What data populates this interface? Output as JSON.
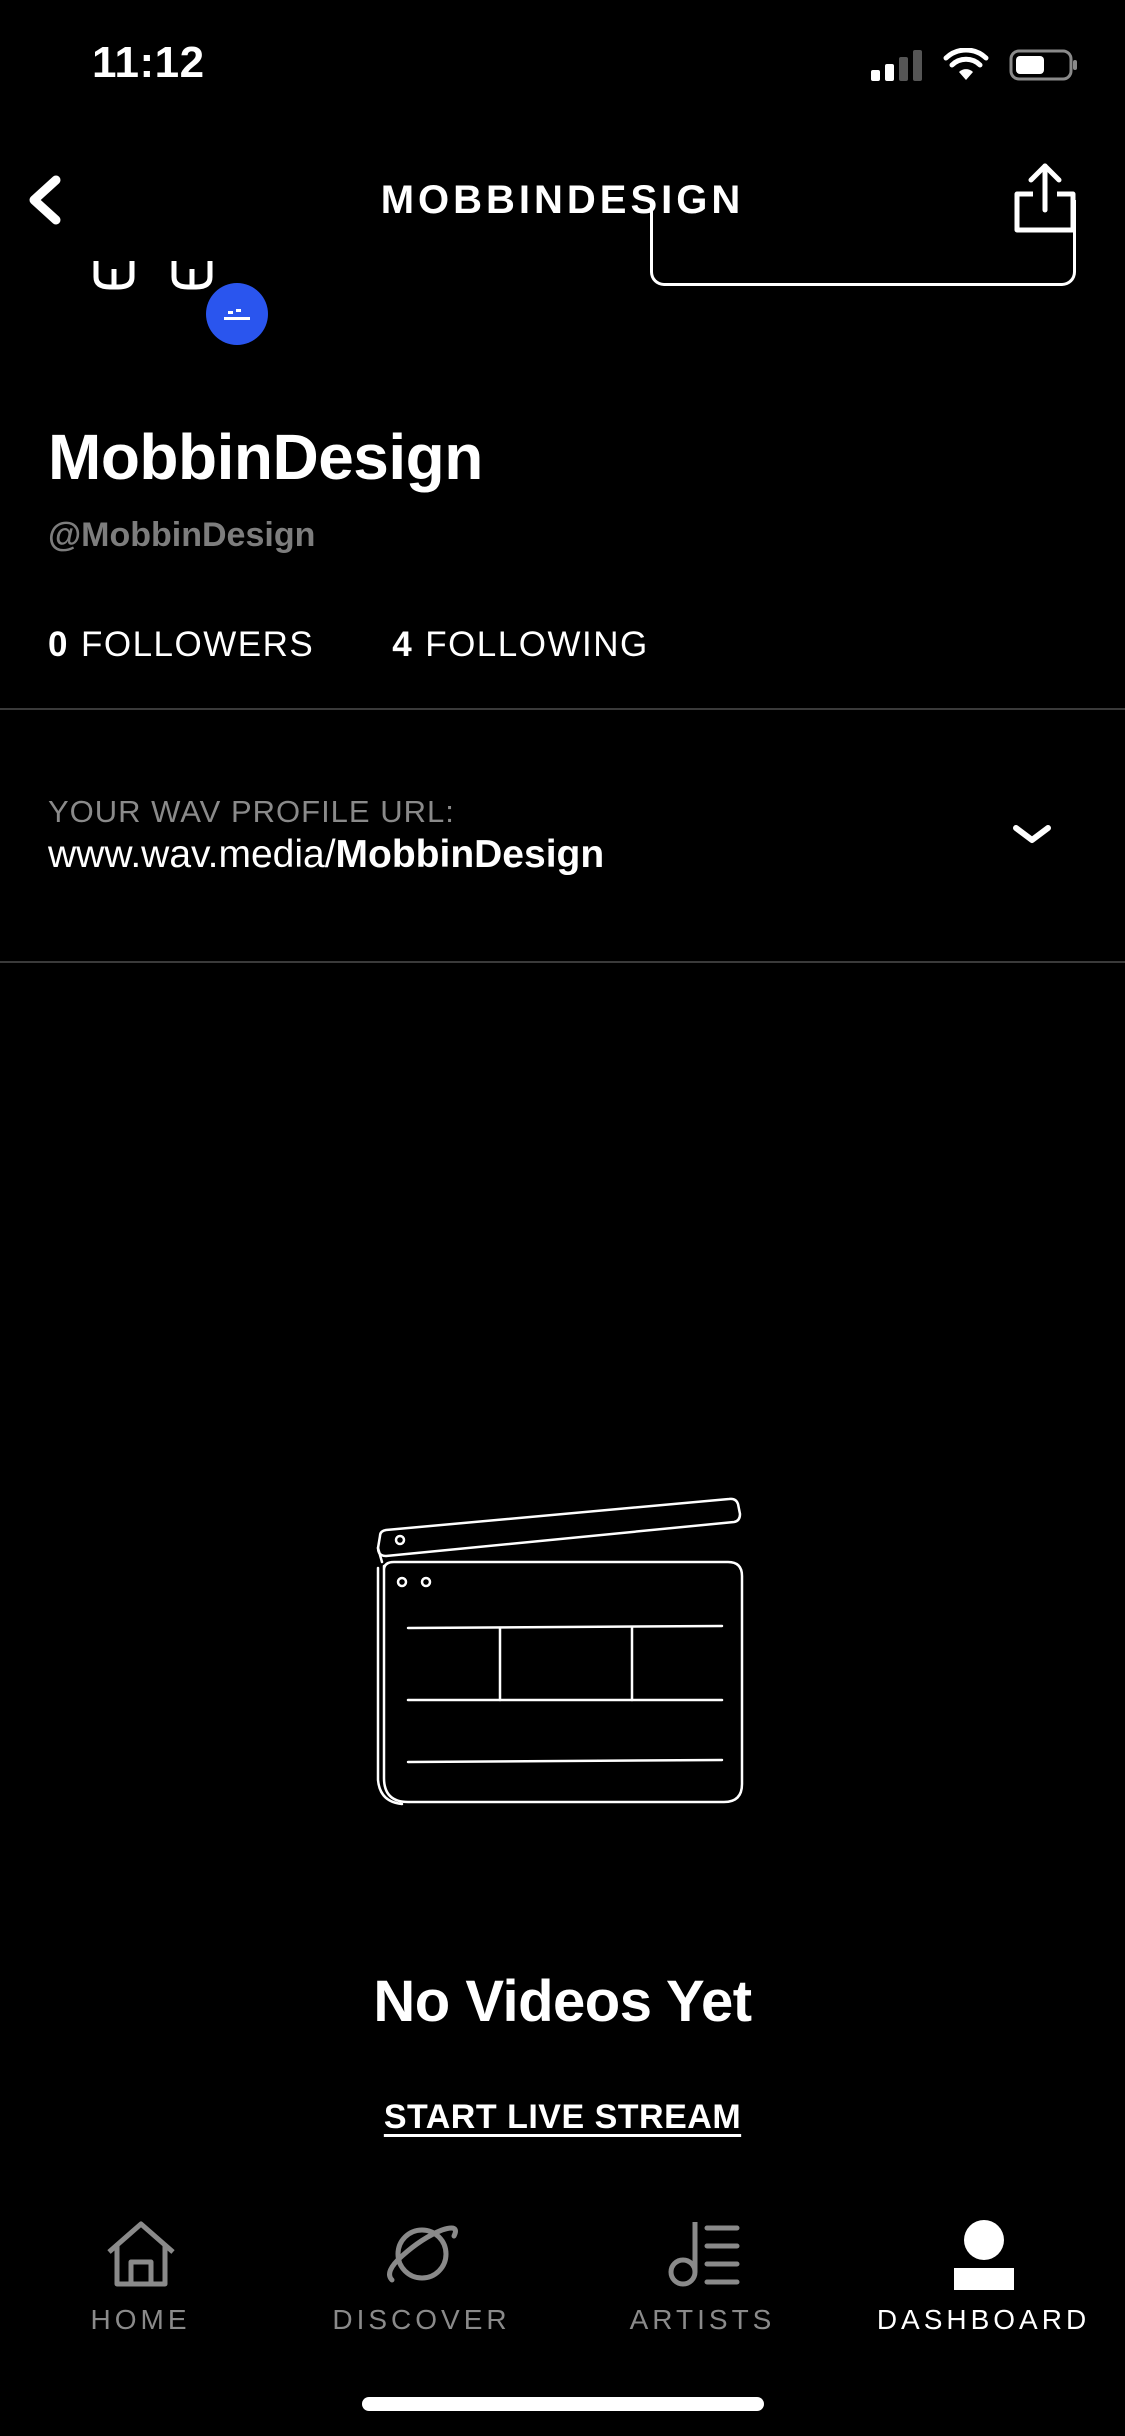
{
  "status_bar": {
    "time": "11:12"
  },
  "nav": {
    "title": "MOBBINDESIGN",
    "back_icon": "chevron-left-icon",
    "share_icon": "share-icon"
  },
  "profile": {
    "name": "MobbinDesign",
    "handle": "@MobbinDesign",
    "followers_count": "0",
    "followers_label": "FOLLOWERS",
    "following_count": "4",
    "following_label": "FOLLOWING"
  },
  "profile_url": {
    "label": "YOUR WAV PROFILE URL:",
    "prefix": "www.wav.media/",
    "username": "MobbinDesign"
  },
  "empty_state": {
    "icon": "clapperboard-icon",
    "title": "No Videos Yet",
    "action": "START LIVE STREAM"
  },
  "tabbar": {
    "items": [
      {
        "label": "HOME",
        "icon": "home-icon",
        "active": false
      },
      {
        "label": "DISCOVER",
        "icon": "planet-icon",
        "active": false
      },
      {
        "label": "ARTISTS",
        "icon": "music-note-list-icon",
        "active": false
      },
      {
        "label": "DASHBOARD",
        "icon": "user-icon",
        "active": true
      }
    ]
  },
  "colors": {
    "background": "#000000",
    "text": "#ffffff",
    "muted": "#8a8a8a",
    "badge": "#2a55ee"
  }
}
